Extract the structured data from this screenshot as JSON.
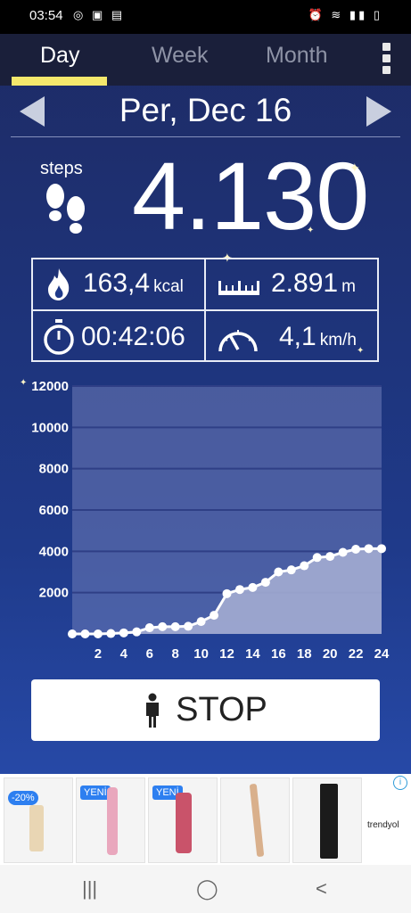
{
  "status_bar": {
    "time": "03:54"
  },
  "tabs": [
    {
      "label": "Day",
      "active": true
    },
    {
      "label": "Week",
      "active": false
    },
    {
      "label": "Month",
      "active": false
    }
  ],
  "date": "Per, Dec 16",
  "steps": {
    "label": "steps",
    "value": "4.130"
  },
  "stats": {
    "calories": {
      "value": "163,4",
      "unit": "kcal"
    },
    "distance": {
      "value": "2.891",
      "unit": "m"
    },
    "duration": {
      "value": "00:42:06"
    },
    "speed": {
      "value": "4,1",
      "unit": "km/h"
    }
  },
  "chart_data": {
    "type": "area",
    "x": [
      0,
      1,
      2,
      3,
      4,
      5,
      6,
      7,
      8,
      9,
      10,
      11,
      12,
      13,
      14,
      15,
      16,
      17,
      18,
      19,
      20,
      21,
      22,
      23,
      24
    ],
    "values": [
      0,
      0,
      0,
      20,
      50,
      100,
      300,
      350,
      350,
      370,
      600,
      900,
      1950,
      2150,
      2250,
      2500,
      3000,
      3100,
      3300,
      3700,
      3750,
      3950,
      4100,
      4130,
      4130
    ],
    "x_ticks": [
      "2",
      "4",
      "6",
      "8",
      "10",
      "12",
      "14",
      "16",
      "18",
      "20",
      "22",
      "24"
    ],
    "y_ticks": [
      "2000",
      "4000",
      "6000",
      "8000",
      "10000",
      "12000"
    ],
    "ylim": [
      0,
      12000
    ],
    "xlim": [
      0,
      24
    ],
    "grid": true,
    "colors": {
      "fill": "#a3acd2",
      "grid": "#2f3f86",
      "points": "#ffffff"
    }
  },
  "stop_button": {
    "label": "STOP"
  },
  "ad": {
    "badges": [
      "YENİ",
      "YENİ"
    ],
    "discount": "-20%",
    "brand": "trendyol"
  },
  "navbar": {
    "recents": "|||",
    "home": "◯",
    "back": "<"
  },
  "colors": {
    "accent": "#f5e86c",
    "background": "#1f3a8a",
    "tabbar": "#1a1f3a"
  }
}
